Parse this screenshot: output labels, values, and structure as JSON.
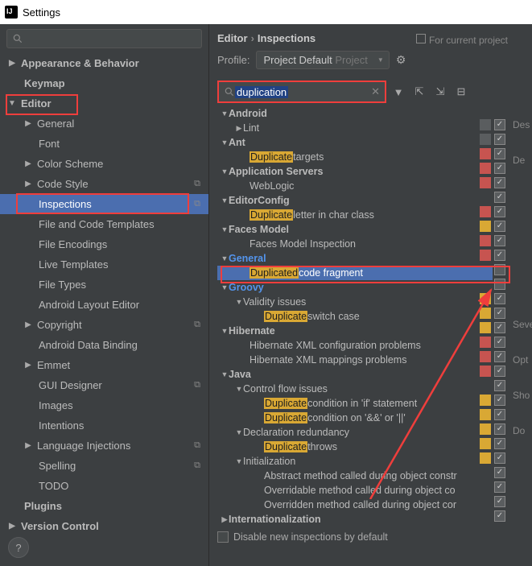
{
  "window": {
    "title": "Settings"
  },
  "breadcrumb": {
    "a": "Editor",
    "b": "Inspections"
  },
  "forProject": "For current project",
  "profile": {
    "label": "Profile:",
    "value": "Project Default",
    "scope": "Project"
  },
  "search": {
    "value": "duplication"
  },
  "left_tree": {
    "appearance": "Appearance & Behavior",
    "keymap": "Keymap",
    "editor": "Editor",
    "general": "General",
    "font": "Font",
    "color": "Color Scheme",
    "codestyle": "Code Style",
    "inspections": "Inspections",
    "templates": "File and Code Templates",
    "encodings": "File Encodings",
    "live": "Live Templates",
    "filetypes": "File Types",
    "layout": "Android Layout Editor",
    "copyright": "Copyright",
    "databind": "Android Data Binding",
    "emmet": "Emmet",
    "gui": "GUI Designer",
    "images": "Images",
    "intentions": "Intentions",
    "lang": "Language Injections",
    "spelling": "Spelling",
    "todo": "TODO",
    "plugins": "Plugins",
    "vcs": "Version Control"
  },
  "insp": {
    "android": "Android",
    "lint": "Lint",
    "ant": "Ant",
    "dup": "Duplicate",
    "targets": " targets",
    "appservers": "Application Servers",
    "weblogic": "WebLogic",
    "editorconfig": "EditorConfig",
    "letter": " letter in char class",
    "faces": "Faces Model",
    "facesinsp": "Faces Model Inspection",
    "general": "General",
    "duped": "Duplicated",
    "codefrag": " code fragment",
    "groovy": "Groovy",
    "validity": "Validity issues",
    "switchcase": " switch case",
    "hibernate": "Hibernate",
    "hib1": "Hibernate XML configuration problems",
    "hib2": "Hibernate XML mappings problems",
    "java": "Java",
    "cflow": "Control flow issues",
    "condif": " condition in 'if' statement",
    "condand": " condition on '&&' or '||'",
    "decl": "Declaration redundancy",
    "throws": " throws",
    "init": "Initialization",
    "abs": "Abstract method called during object constr",
    "ovr": "Overridable method called during object co",
    "ovd": "Overridden method called during object cor",
    "intl": "Internationalization"
  },
  "footer": "Disable new inspections by default",
  "rpanel": {
    "desc": "Des",
    "det": "De",
    "sev": "Seve",
    "opt": "Opt",
    "sho": "Sho",
    "do": "Do"
  },
  "chart_data": null
}
